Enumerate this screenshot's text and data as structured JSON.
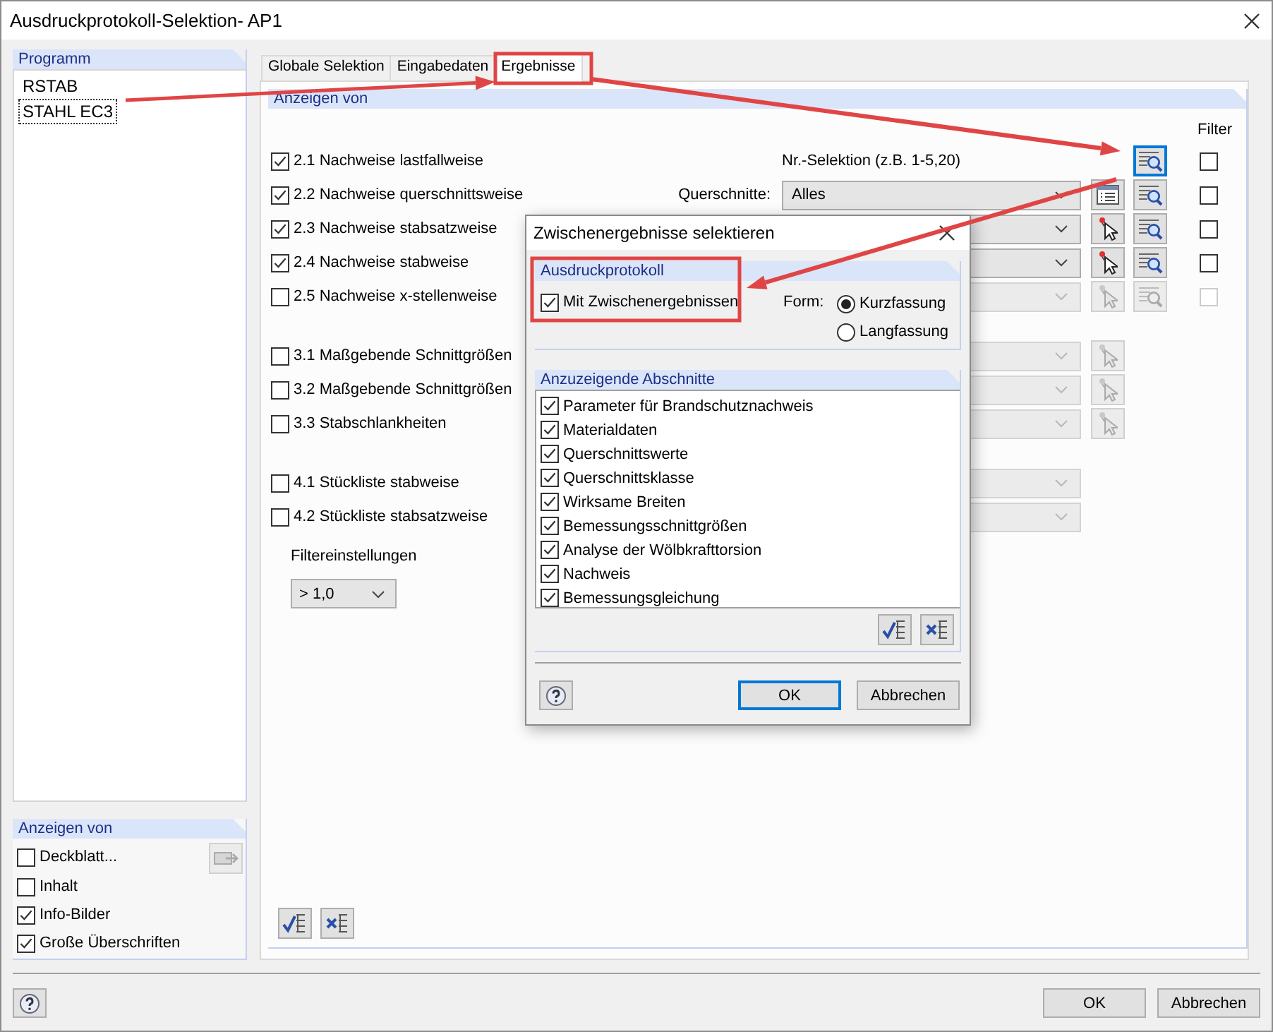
{
  "window": {
    "title": "Ausdruckprotokoll-Selektion- AP1"
  },
  "program": {
    "heading": "Programm",
    "items": [
      {
        "label": "RSTAB",
        "selected": false
      },
      {
        "label": "STAHL EC3",
        "selected": true
      }
    ]
  },
  "display": {
    "heading": "Anzeigen von",
    "items": [
      {
        "label": "Deckblatt...",
        "checked": false,
        "kind": "with_button"
      },
      {
        "label": "Inhalt",
        "checked": false,
        "kind": "plain"
      },
      {
        "label": "Info-Bilder",
        "checked": true,
        "kind": "plain"
      },
      {
        "label": "Große Überschriften",
        "checked": true,
        "kind": "plain"
      }
    ]
  },
  "tabs": [
    {
      "label": "Globale Selektion",
      "selected": false
    },
    {
      "label": "Eingabedaten",
      "selected": false
    },
    {
      "label": "Ergebnisse",
      "selected": true
    }
  ],
  "results": {
    "heading": "Anzeigen von",
    "filter_heading": "Filter",
    "groups": [
      {
        "rows": [
          {
            "label": "2.1 Nachweise lastfallweise",
            "checked": true,
            "kind": "selection",
            "hint": "Nr.-Selektion (z.B. 1-5,20)",
            "search": true,
            "filter_checked": false,
            "disabled": false
          },
          {
            "label": "2.2 Nachweise querschnittsweise",
            "checked": true,
            "kind": "dropdown",
            "field_label": "Querschnitte:",
            "value": "Alles",
            "tool": {
              "kind": "list"
            },
            "search": true,
            "filter_checked": false,
            "disabled": false
          },
          {
            "label": "2.3 Nachweise stabsatzweise",
            "checked": true,
            "kind": "dropdown",
            "tool": {
              "kind": "pick"
            },
            "search": true,
            "filter_checked": false,
            "disabled": false
          },
          {
            "label": "2.4 Nachweise stabweise",
            "checked": true,
            "kind": "dropdown",
            "tool": {
              "kind": "pick"
            },
            "search": true,
            "filter_checked": false,
            "disabled": false
          },
          {
            "label": "2.5 Nachweise x-stellenweise",
            "checked": false,
            "kind": "dropdown",
            "tool": {
              "kind": "pick"
            },
            "search": true,
            "filter_checked": false,
            "disabled": true
          }
        ]
      },
      {
        "rows": [
          {
            "label": "3.1 Maßgebende Schnittgrößen",
            "checked": false,
            "kind": "dropdown",
            "tool": {
              "kind": "pick"
            },
            "search": false,
            "disabled": true
          },
          {
            "label": "3.2 Maßgebende Schnittgrößen",
            "checked": false,
            "kind": "dropdown",
            "tool": {
              "kind": "pick"
            },
            "search": false,
            "disabled": true
          },
          {
            "label": "3.3 Stabschlankheiten",
            "checked": false,
            "kind": "dropdown",
            "tool": {
              "kind": "pick"
            },
            "search": false,
            "disabled": true
          }
        ]
      },
      {
        "rows": [
          {
            "label": "4.1 Stückliste stabweise",
            "checked": false,
            "kind": "dropdown",
            "search": false,
            "disabled": true
          },
          {
            "label": "4.2 Stückliste stabsatzweise",
            "checked": false,
            "kind": "dropdown",
            "search": false,
            "disabled": true
          }
        ]
      }
    ],
    "filter_settings": {
      "label": "Filtereinstellungen",
      "value": "> 1,0"
    }
  },
  "dialog": {
    "title": "Zwischenergebnisse selektieren",
    "protocol": {
      "heading": "Ausdruckprotokoll",
      "option": {
        "label": "Mit Zwischenergebnissen",
        "checked": true
      },
      "form_label": "Form:",
      "forms": [
        {
          "label": "Kurzfassung",
          "selected": true
        },
        {
          "label": "Langfassung",
          "selected": false
        }
      ]
    },
    "sections": {
      "heading": "Anzuzeigende Abschnitte",
      "items": [
        {
          "label": "Parameter für Brandschutznachweis",
          "checked": true
        },
        {
          "label": "Materialdaten",
          "checked": true
        },
        {
          "label": "Querschnittswerte",
          "checked": true
        },
        {
          "label": "Querschnittsklasse",
          "checked": true
        },
        {
          "label": "Wirksame Breiten",
          "checked": true
        },
        {
          "label": "Bemessungsschnittgrößen",
          "checked": true
        },
        {
          "label": "Analyse der Wölbkrafttorsion",
          "checked": true
        },
        {
          "label": "Nachweis",
          "checked": true
        },
        {
          "label": "Bemessungsgleichung",
          "checked": true
        }
      ]
    },
    "buttons": [
      {
        "label": "OK",
        "default": true
      },
      {
        "label": "Abbrechen",
        "default": false
      }
    ]
  },
  "buttons": [
    {
      "label": "OK",
      "default": false
    },
    {
      "label": "Abbrechen",
      "default": false
    }
  ]
}
